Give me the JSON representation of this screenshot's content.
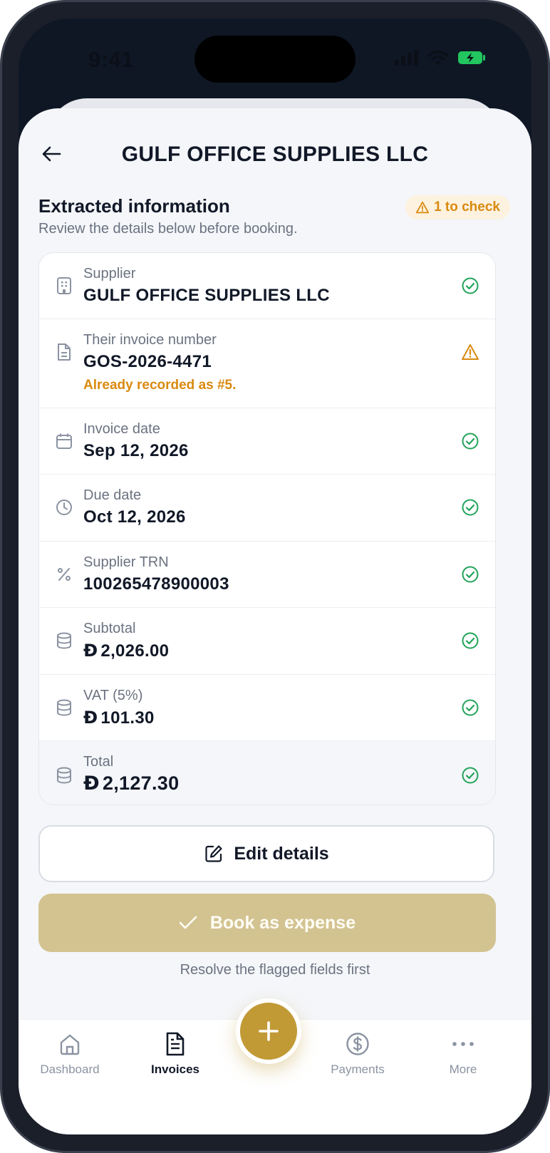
{
  "status_bar": {
    "time": "9:41",
    "icons": [
      "signal-icon",
      "wifi-icon",
      "battery-charging-icon"
    ]
  },
  "header": {
    "title": "GULF OFFICE SUPPLIES LLC",
    "back_icon": "arrow-left-icon"
  },
  "section": {
    "title": "Extracted information",
    "subtitle": "Review the details below before booking.",
    "badge": "1 to check"
  },
  "fields": [
    {
      "label": "Supplier",
      "value": "GULF OFFICE SUPPLIES LLC",
      "icon": "building-icon",
      "status": "ok"
    },
    {
      "label": "Their invoice number",
      "value": "GOS-2026-4471",
      "icon": "document-icon",
      "status": "warning",
      "warning": "Already recorded as #5."
    },
    {
      "label": "Invoice date",
      "value": "Sep 12, 2026",
      "icon": "calendar-icon",
      "status": "ok"
    },
    {
      "label": "Due date",
      "value": "Oct 12, 2026",
      "icon": "clock-icon",
      "status": "ok"
    },
    {
      "label": "Supplier TRN",
      "value": "100265478900003",
      "icon": "percent-icon",
      "status": "ok"
    },
    {
      "label": "Subtotal",
      "currency": "Đ",
      "value": "2,026.00",
      "icon": "coins-icon",
      "status": "ok"
    },
    {
      "label": "VAT (5%)",
      "currency": "Đ",
      "value": "101.30",
      "icon": "coins-icon",
      "status": "ok"
    },
    {
      "label": "Total",
      "currency": "Đ",
      "value": "2,127.30",
      "icon": "coins-icon",
      "status": "ok"
    }
  ],
  "actions": {
    "edit_label": "Edit details",
    "book_label": "Book as expense",
    "hint": "Resolve the flagged fields first"
  },
  "tabbar": {
    "tabs": [
      {
        "label": "Dashboard",
        "icon": "home-icon",
        "active": false
      },
      {
        "label": "Invoices",
        "icon": "invoice-icon",
        "active": true
      },
      {
        "label": "Payments",
        "icon": "dollar-circle-icon",
        "active": false
      },
      {
        "label": "More",
        "icon": "more-dots-icon",
        "active": false
      }
    ],
    "fab_icon": "plus-icon"
  },
  "colors": {
    "accent": "#c19a36",
    "book_disabled": "#d3c391",
    "success": "#22a35a",
    "warning": "#d98a10",
    "text": "#111827",
    "muted": "#6b7280"
  }
}
